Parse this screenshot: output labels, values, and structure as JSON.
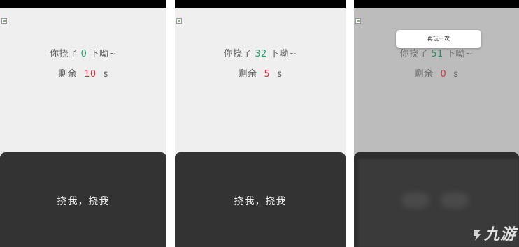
{
  "panels": [
    {
      "count_prefix": "你挠了",
      "count": "0",
      "count_suffix": "下呦~",
      "remain_prefix": "剩余",
      "remain": "10",
      "remain_unit": "s",
      "button_label": "挠我，挠我"
    },
    {
      "count_prefix": "你挠了",
      "count": "32",
      "count_suffix": "下呦~",
      "remain_prefix": "剩余",
      "remain": "5",
      "remain_unit": "s",
      "button_label": "挠我，挠我"
    },
    {
      "count_prefix": "你挠了",
      "count": "51",
      "count_suffix": "下呦~",
      "remain_prefix": "剩余",
      "remain": "0",
      "remain_unit": "s",
      "toast_label": "再玩一次"
    }
  ],
  "watermark": "九游",
  "colors": {
    "count": "#29a36a",
    "remain": "#d9303a",
    "card": "#333333"
  }
}
